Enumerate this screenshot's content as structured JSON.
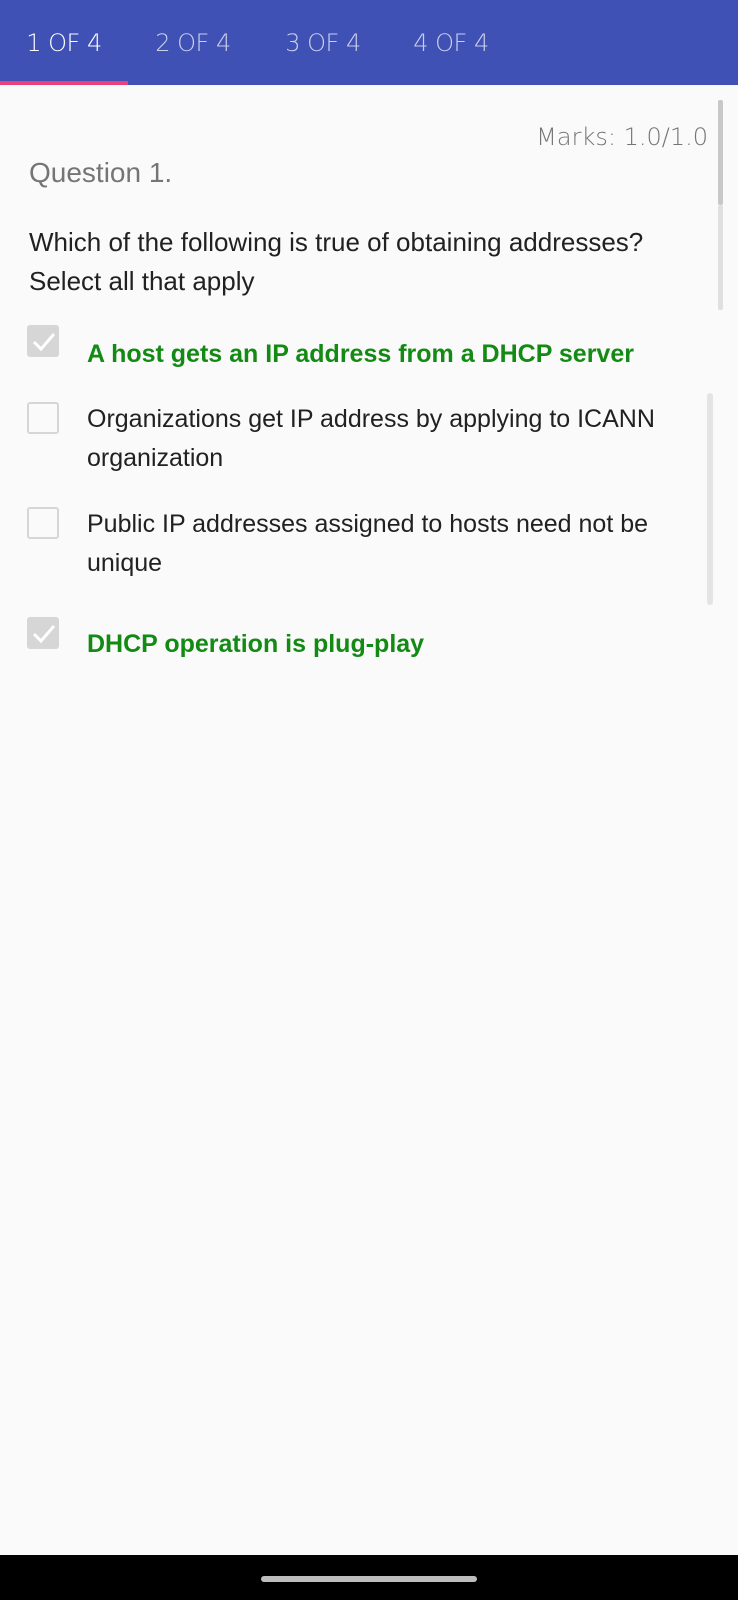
{
  "tabs": [
    {
      "label": "1 OF 4",
      "active": true
    },
    {
      "label": "2 OF 4",
      "active": false
    },
    {
      "label": "3 OF 4",
      "active": false
    },
    {
      "label": "4 OF 4",
      "active": false
    }
  ],
  "question": {
    "marks": "Marks: 1.0/1.0",
    "number": "Question 1.",
    "text": "Which of the following is true of obtaining addresses? Select all that apply",
    "options": [
      {
        "text": "A host gets an IP address from a DHCP server",
        "checked": true,
        "correct": true
      },
      {
        "text": "Organizations get IP address by applying to ICANN organization",
        "checked": false,
        "correct": false
      },
      {
        "text": "Public IP addresses assigned to hosts need not be unique",
        "checked": false,
        "correct": false
      },
      {
        "text": "DHCP operation is plug-play",
        "checked": true,
        "correct": true
      }
    ]
  },
  "colors": {
    "tab_bar": "#3f51b5",
    "tab_indicator": "#ec407a",
    "correct_text": "#138a14",
    "checkbox_disabled": "#d6d6d6"
  }
}
